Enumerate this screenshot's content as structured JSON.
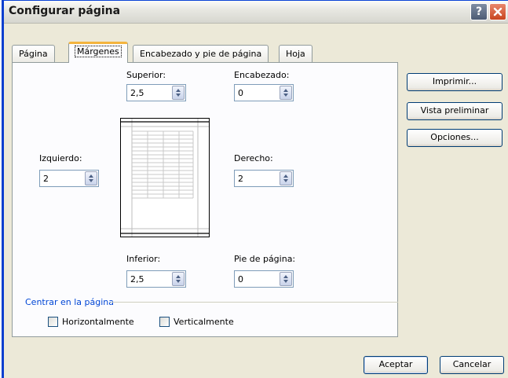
{
  "window": {
    "title": "Configurar página",
    "help_glyph": "?",
    "help_icon": "help-icon",
    "close_icon": "close-icon"
  },
  "tabs": [
    {
      "label": "Página",
      "active": false
    },
    {
      "label": "Márgenes",
      "active": true
    },
    {
      "label": "Encabezado y pie de página",
      "active": false
    },
    {
      "label": "Hoja",
      "active": false
    }
  ],
  "margins": {
    "superior": {
      "label": "Superior:",
      "value": "2,5"
    },
    "encabezado": {
      "label": "Encabezado:",
      "value": "0"
    },
    "izquierdo": {
      "label": "Izquierdo:",
      "value": "2"
    },
    "derecho": {
      "label": "Derecho:",
      "value": "2"
    },
    "inferior": {
      "label": "Inferior:",
      "value": "2,5"
    },
    "pie": {
      "label": "Pie de página:",
      "value": "0"
    }
  },
  "center": {
    "title": "Centrar en la página",
    "horizontal": {
      "label": "Horizontalmente",
      "checked": false
    },
    "vertical": {
      "label": "Verticalmente",
      "checked": false
    }
  },
  "side_buttons": {
    "print": "Imprimir...",
    "preview": "Vista preliminar",
    "options": "Opciones..."
  },
  "footer_buttons": {
    "ok": "Aceptar",
    "cancel": "Cancelar"
  },
  "colors": {
    "title_border": "#0a3fcf",
    "section_title": "#0046d5",
    "active_tab_accent": "#f4b43e",
    "close_button": "#c8451f"
  }
}
